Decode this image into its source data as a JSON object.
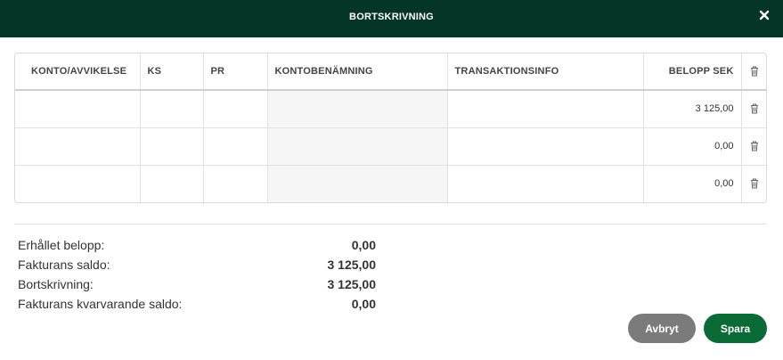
{
  "dialog": {
    "title": "BORTSKRIVNING"
  },
  "table": {
    "columns": [
      "KONTO/AVVIKELSE",
      "KS",
      "PR",
      "KONTOBENÄMNING",
      "TRANSAKTIONSINFO",
      "BELOPP SEK"
    ],
    "rows": [
      {
        "konto": "",
        "ks": "",
        "pr": "",
        "kontobenamning": "",
        "transaktionsinfo": "",
        "belopp": "3 125,00"
      },
      {
        "konto": "",
        "ks": "",
        "pr": "",
        "kontobenamning": "",
        "transaktionsinfo": "",
        "belopp": "0,00"
      },
      {
        "konto": "",
        "ks": "",
        "pr": "",
        "kontobenamning": "",
        "transaktionsinfo": "",
        "belopp": "0,00"
      }
    ]
  },
  "summary": [
    {
      "label": "Erhållet belopp:",
      "value": "0,00"
    },
    {
      "label": "Fakturans saldo:",
      "value": "3 125,00"
    },
    {
      "label": "Bortskrivning:",
      "value": "3 125,00"
    },
    {
      "label": "Fakturans kvarvarande saldo:",
      "value": "0,00"
    }
  ],
  "buttons": {
    "cancel": "Avbryt",
    "save": "Spara"
  },
  "colors": {
    "header_bg": "#053526",
    "save_bg": "#0a6b37",
    "cancel_bg": "#7b7b7b"
  },
  "icons": {
    "close": "close-icon",
    "delete": "trash-icon"
  }
}
